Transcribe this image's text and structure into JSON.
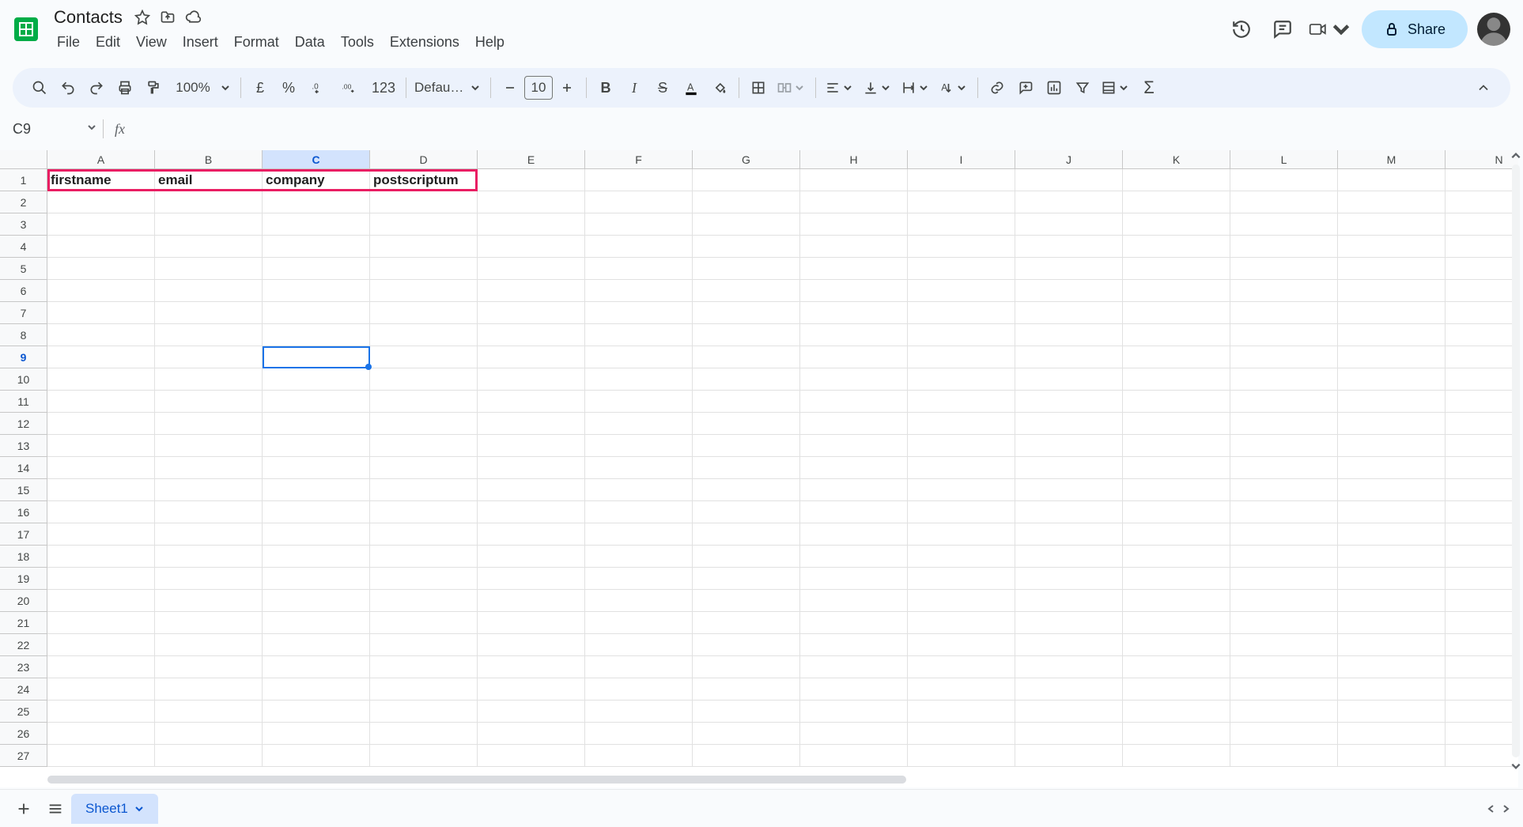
{
  "doc": {
    "title": "Contacts"
  },
  "menus": [
    "File",
    "Edit",
    "View",
    "Insert",
    "Format",
    "Data",
    "Tools",
    "Extensions",
    "Help"
  ],
  "right": {
    "share_label": "Share"
  },
  "toolbar": {
    "zoom": "100%",
    "currency_symbol": "£",
    "format_123": "123",
    "font_name": "Defaul…",
    "font_size": "10",
    "text_color_underline": "#000000"
  },
  "name_box": "C9",
  "formula": "",
  "columns": [
    "A",
    "B",
    "C",
    "D",
    "E",
    "F",
    "G",
    "H",
    "I",
    "J",
    "K",
    "L",
    "M",
    "N"
  ],
  "selected_col_index": 2,
  "rows": 27,
  "selected_row": 9,
  "row1": [
    "firstname",
    "email",
    "company",
    "postscriptum"
  ],
  "highlight": {
    "cols": 4
  },
  "selection": {
    "col": 2,
    "row": 8
  },
  "sheet_tabs": {
    "active": "Sheet1"
  }
}
